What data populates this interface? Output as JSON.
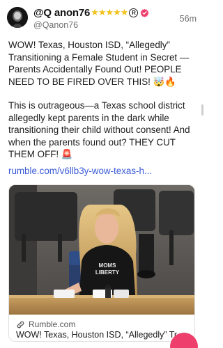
{
  "post": {
    "display_name": "@Q anon76",
    "rating_stars": "★★★★★",
    "rating_count": 5,
    "registered_mark": "R",
    "handle": "@Qanon76",
    "timestamp": "56m",
    "paragraph_1": "WOW! Texas, Houston ISD, “Allegedly” Transitioning a Female Student in Secret — Parents Accidentally Found Out! PEOPLE NEED TO BE FIRED OVER THIS! 🤯🔥",
    "paragraph_2": "This is outrageous—a Texas school district allegedly kept parents in the dark while transitioning their child without consent! And when the parents found out? THEY CUT THEM OFF! 🚨",
    "link_text": "rumble.com/v6llb3y-wow-texas-h..."
  },
  "link_card": {
    "image_sign_text_line1": "MOMS",
    "image_sign_text_line2": "LIBERTY",
    "source": "Rumble.com",
    "title": "WOW! Texas, Houston ISD, “Allegedly” Transitioning a Female Student in Secret"
  },
  "icons": {
    "avatar": "avatar-icon",
    "verified": "verified-badge-icon",
    "link": "link-icon",
    "compose": "compose-fab-icon"
  },
  "colors": {
    "link": "#3b5bd6",
    "verified_badge": "#ee3e6c",
    "stars": "#f3c21b",
    "fab": "#ee3e6c"
  }
}
